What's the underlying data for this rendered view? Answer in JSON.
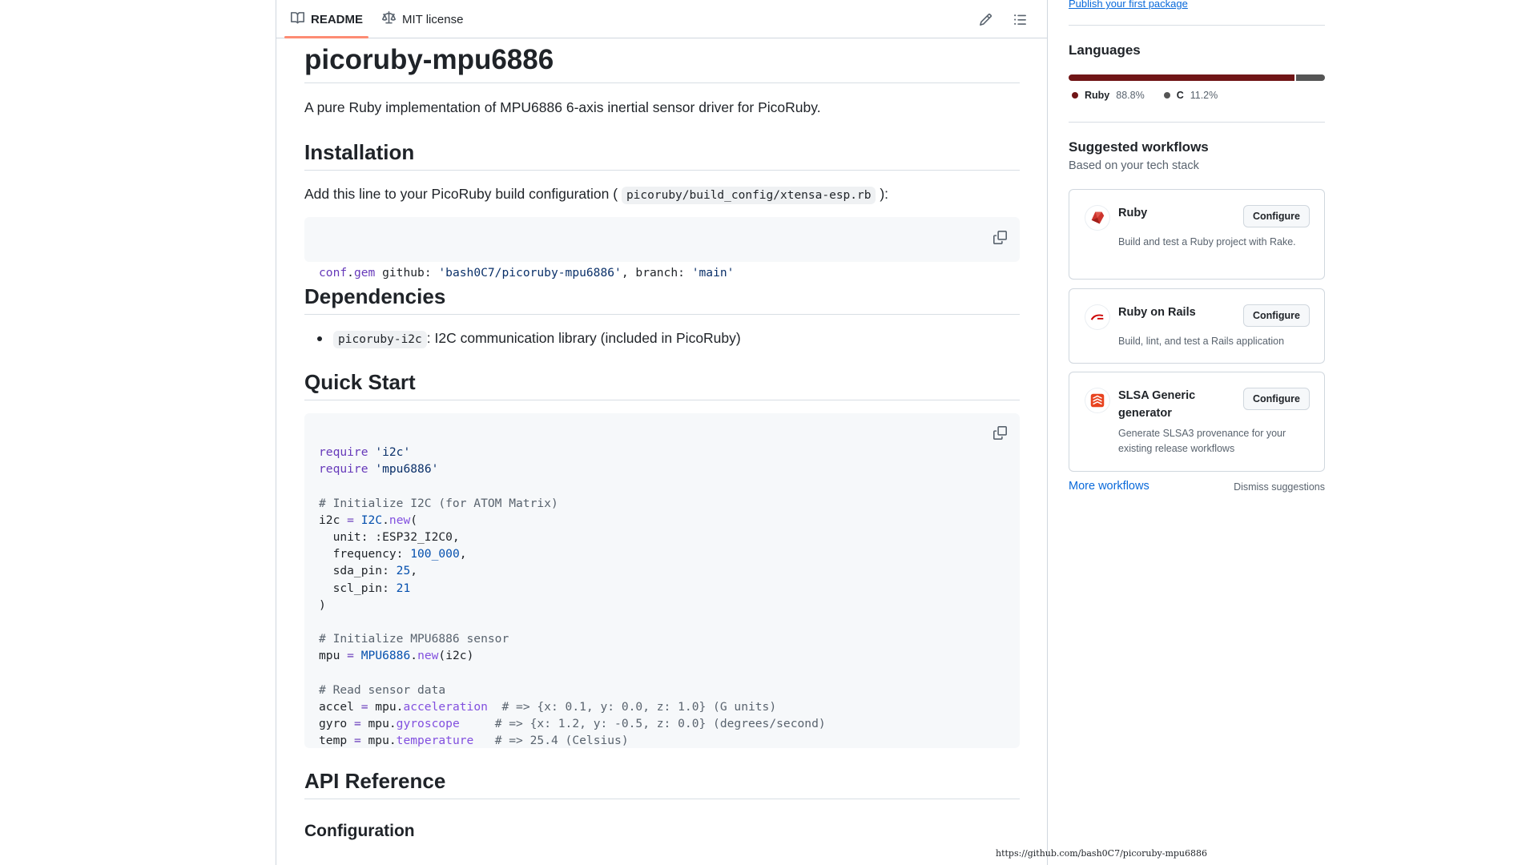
{
  "readme": {
    "tabs": [
      {
        "label": "README",
        "icon": "book-icon",
        "active": true
      },
      {
        "label": "MIT license",
        "icon": "law-icon",
        "active": false
      }
    ],
    "tools": [
      "pencil-icon",
      "list-unordered-icon"
    ],
    "title": "picoruby-mpu6886",
    "intro": "A pure Ruby implementation of MPU6886 6-axis inertial sensor driver for PicoRuby.",
    "installation": {
      "heading": "Installation",
      "text_before": "Add this line to your PicoRuby build configuration (",
      "code_path": "picoruby/build_config/xtensa-esp.rb",
      "text_after": "):",
      "code_line": "conf.gem github: 'bash0C7/picoruby-mpu6886', branch: 'main'"
    },
    "dependencies": {
      "heading": "Dependencies",
      "items": [
        {
          "code": "picoruby-i2c",
          "text": ": I2C communication library (included in PicoRuby)"
        }
      ]
    },
    "quick_start": {
      "heading": "Quick Start",
      "code_lines": [
        "require 'i2c'",
        "require 'mpu6886'",
        "",
        "# Initialize I2C (for ATOM Matrix)",
        "i2c = I2C.new(",
        "  unit: :ESP32_I2C0,",
        "  frequency: 100_000,",
        "  sda_pin: 25,",
        "  scl_pin: 21",
        ")",
        "",
        "# Initialize MPU6886 sensor",
        "mpu = MPU6886.new(i2c)",
        "",
        "# Read sensor data",
        "accel = mpu.acceleration  # => {x: 0.1, y: 0.0, z: 1.0} (G units)",
        "gyro = mpu.gyroscope     # => {x: 1.2, y: -0.5, z: 0.0} (degrees/second)",
        "temp = mpu.temperature   # => 25.4 (Celsius)"
      ]
    },
    "api_heading": "API Reference",
    "config_heading": "Configuration"
  },
  "sidebar": {
    "publish_link": "Publish your first package",
    "languages": {
      "heading": "Languages",
      "items": [
        {
          "name": "Ruby",
          "percent": 88.8,
          "percent_label": "88.8%",
          "color": "#701516"
        },
        {
          "name": "C",
          "percent": 11.2,
          "percent_label": "11.2%",
          "color": "#555555"
        }
      ]
    },
    "workflows": {
      "heading": "Suggested workflows",
      "subtitle": "Based on your tech stack",
      "cards": [
        {
          "title": "Ruby",
          "desc": "Build and test a Ruby project with Rake.",
          "button": "Configure",
          "icon": "ruby-icon"
        },
        {
          "title": "Ruby on Rails",
          "desc": "Build, lint, and test a Rails application",
          "button": "Configure",
          "icon": "rails-icon"
        },
        {
          "title": "SLSA Generic generator",
          "desc": "Generate SLSA3 provenance for your existing release workflows",
          "button": "Configure",
          "icon": "slsa-icon"
        }
      ],
      "more": "More workflows",
      "dismiss": "Dismiss suggestions"
    }
  },
  "footer_url": "https://github.com/bash0C7/picoruby-mpu6886",
  "colors": {
    "accent_link": "#0969da",
    "tab_underline": "#fd8c73",
    "code_bg": "#f6f8fa"
  }
}
